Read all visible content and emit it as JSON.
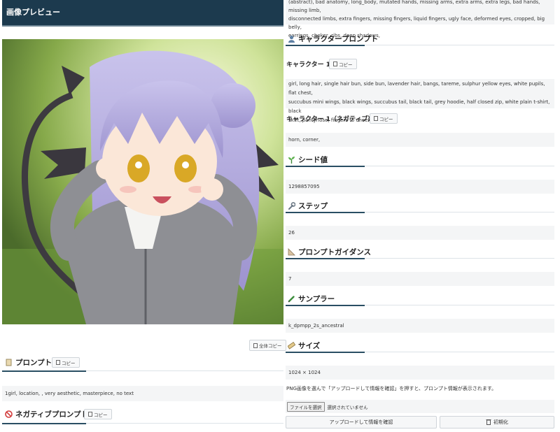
{
  "left": {
    "header_title": "画像プレビュー",
    "full_copy_label": "全体コピー",
    "prompt_title": "プロンプト",
    "prompt_copy_label": "コピー",
    "prompt_text": "1girl, location, , very aesthetic, masterpiece, no text",
    "negative_title": "ネガティブプロンプト",
    "negative_copy_label": "コピー"
  },
  "right": {
    "negative_text_lines": [
      "(abstract), bad anatomy, long_body, mutated hands, missing arms, extra arms, extra legs, bad hands, missing limb,",
      "disconnected limbs, extra fingers, missing fingers, liquid fingers, ugly face, deformed eyes, cropped, big belly,",
      "earrings, choker, ribs, deep shadows,"
    ],
    "character_prompt_title": "キャラクタープロンプト",
    "character1_label": "キャラクター 1",
    "character1_copy_label": "コピー",
    "character1_text_lines": [
      "girl, long hair, single hair bun, side bun, lavender hair, bangs, tareme, sulphur yellow eyes, white pupils, flat chest,",
      "succubus mini wings, black wings, succubus tail, black tail, grey hoodie, half closed zip, white plain t-shirt, black",
      "skirt, pantyhose, fingers to cheek"
    ],
    "character1_negative_label": "キャラクター 1（ネガティブ）",
    "character1_negative_copy_label": "コピー",
    "character1_negative_text": "horn, corner,",
    "seed_title": "シード値",
    "seed_value": "1298857095",
    "steps_title": "ステップ",
    "steps_value": "26",
    "guidance_title": "プロンプトガイダンス",
    "guidance_value": "7",
    "sampler_title": "サンプラー",
    "sampler_value": "k_dpmpp_2s_ancestral",
    "size_title": "サイズ",
    "size_value": "1024 × 1024",
    "instruction_text": "PNG画像を選んで「アップロードして情報を確認」を押すと、プロンプト情報が表示されます。",
    "file_button_label": "ファイルを選択",
    "file_status": "選択されていません",
    "upload_button_label": "アップロードして情報を確認",
    "reset_button_label": "初期化"
  },
  "colors": {
    "header_bg": "#1c3a4e",
    "section_rule": "#2a4e63",
    "value_box_bg": "#f4f5f6"
  },
  "icons": [
    "page-icon",
    "no-entry-icon",
    "person-icon",
    "sprout-icon",
    "wrench-icon",
    "ruler-triangle-icon",
    "pencil-icon",
    "ruler-icon",
    "clipboard-icon",
    "trash-icon"
  ]
}
